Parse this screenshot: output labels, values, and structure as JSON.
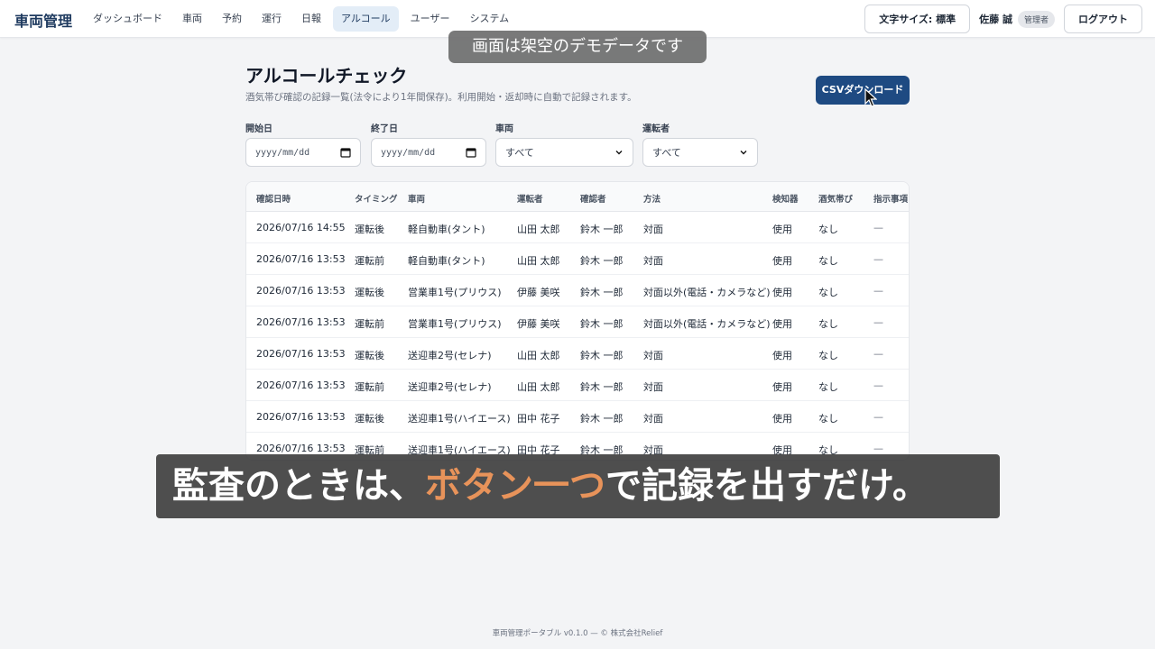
{
  "header": {
    "brand": "車両管理",
    "nav": [
      "ダッシュボード",
      "車両",
      "予約",
      "運行",
      "日報",
      "アルコール",
      "ユーザー",
      "システム"
    ],
    "active_nav": "アルコール",
    "font_size_button": "文字サイズ: 標準",
    "user_name": "佐藤 誠",
    "user_role": "管理者",
    "logout_button": "ログアウト"
  },
  "demo_badge": "画面は架空のデモデータです",
  "page": {
    "title": "アルコールチェック",
    "description": "酒気帯び確認の記録一覧(法令により1年間保存)。利用開始・返却時に自動で記録されます。",
    "csv_button": "CSVダウンロード"
  },
  "filters": {
    "start_label": "開始日",
    "start_placeholder": "yyyy/mm/dd",
    "end_label": "終了日",
    "end_placeholder": "yyyy/mm/dd",
    "vehicle_label": "車両",
    "vehicle_value": "すべて",
    "driver_label": "運転者",
    "driver_value": "すべて"
  },
  "table": {
    "columns": [
      "確認日時",
      "タイミング",
      "車両",
      "運転者",
      "確認者",
      "方法",
      "検知器",
      "酒気帯び",
      "指示事項"
    ],
    "rows": [
      [
        "2026/07/16 14:55",
        "運転後",
        "軽自動車(タント)",
        "山田 太郎",
        "鈴木 一郎",
        "対面",
        "使用",
        "なし",
        "—"
      ],
      [
        "2026/07/16 13:53",
        "運転前",
        "軽自動車(タント)",
        "山田 太郎",
        "鈴木 一郎",
        "対面",
        "使用",
        "なし",
        "—"
      ],
      [
        "2026/07/16 13:53",
        "運転後",
        "営業車1号(プリウス)",
        "伊藤 美咲",
        "鈴木 一郎",
        "対面以外(電話・カメラなど)",
        "使用",
        "なし",
        "—"
      ],
      [
        "2026/07/16 13:53",
        "運転前",
        "営業車1号(プリウス)",
        "伊藤 美咲",
        "鈴木 一郎",
        "対面以外(電話・カメラなど)",
        "使用",
        "なし",
        "—"
      ],
      [
        "2026/07/16 13:53",
        "運転後",
        "送迎車2号(セレナ)",
        "山田 太郎",
        "鈴木 一郎",
        "対面",
        "使用",
        "なし",
        "—"
      ],
      [
        "2026/07/16 13:53",
        "運転前",
        "送迎車2号(セレナ)",
        "山田 太郎",
        "鈴木 一郎",
        "対面",
        "使用",
        "なし",
        "—"
      ],
      [
        "2026/07/16 13:53",
        "運転後",
        "送迎車1号(ハイエース)",
        "田中 花子",
        "鈴木 一郎",
        "対面",
        "使用",
        "なし",
        "—"
      ],
      [
        "2026/07/16 13:53",
        "運転前",
        "送迎車1号(ハイエース)",
        "田中 花子",
        "鈴木 一郎",
        "対面",
        "使用",
        "なし",
        "—"
      ]
    ]
  },
  "subtitle": {
    "before": "監査のときは、",
    "highlight": "ボタン一つ",
    "after": "で記録を出すだけ。"
  },
  "footer": "車両管理ポータブル v0.1.0 — © 株式会社Relief"
}
